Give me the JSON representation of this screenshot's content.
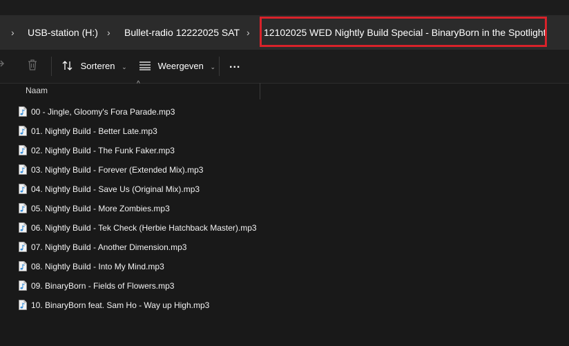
{
  "breadcrumb": {
    "items": [
      "USB-station (H:)",
      "Bullet-radio 12222025 SAT",
      "12102025 WED Nightly Build Special - BinaryBorn in the Spotlight"
    ]
  },
  "toolbar": {
    "sort_label": "Sorteren",
    "view_label": "Weergeven",
    "more_label": "..."
  },
  "column_header": {
    "name": "Naam"
  },
  "files": [
    "00 - Jingle, Gloomy's Fora Parade.mp3",
    "01. Nightly Build - Better Late.mp3",
    "02. Nightly Build - The Funk Faker.mp3",
    "03. Nightly Build - Forever (Extended Mix).mp3",
    "04. Nightly Build - Save Us (Original Mix).mp3",
    "05. Nightly Build - More Zombies.mp3",
    "06. Nightly Build - Tek Check (Herbie Hatchback Master).mp3",
    "07. Nightly Build - Another Dimension.mp3",
    "08. Nightly Build - Into My Mind.mp3",
    "09. BinaryBorn - Fields of Flowers.mp3",
    "10. BinaryBorn feat. Sam Ho - Way up High.mp3"
  ],
  "colors": {
    "highlight_box": "#d9222a",
    "file_icon_note": "#3a8fd8"
  }
}
